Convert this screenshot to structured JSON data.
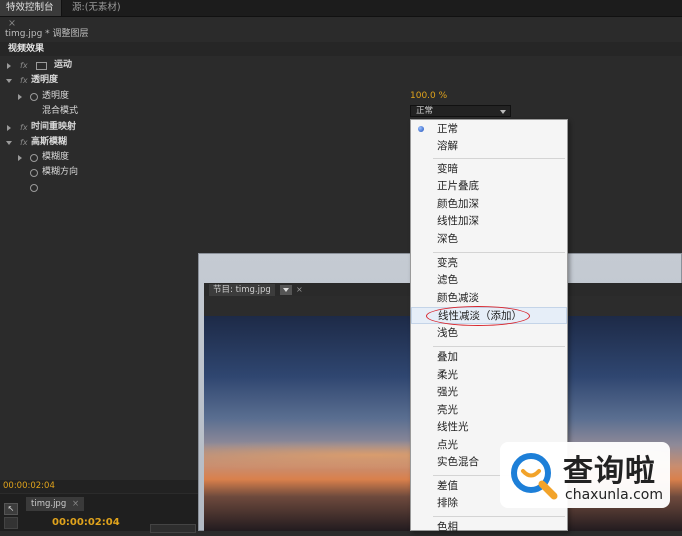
{
  "tabs": {
    "effect_controls": "特效控制台",
    "effect_controls_close": "×",
    "source": "源:(无素材)"
  },
  "clip": {
    "title": "timg.jpg * 调整图层"
  },
  "effects": {
    "section_label": "视频效果",
    "motion": "运动",
    "opacity_group": "透明度",
    "opacity": {
      "label": "透明度",
      "value": "100.0 %"
    },
    "blend_mode": {
      "label": "混合模式",
      "selected": "正常"
    },
    "time_remap": "时间重映射",
    "gaussian_blur": "高斯模糊",
    "blurriness": "模糊度",
    "blur_dimension": "模糊方向"
  },
  "timecode": "00:00:02:04",
  "timeline": {
    "sequence_tab": "timg.jpg",
    "sequence_close": "×",
    "timecode": "00:00:02:04"
  },
  "monitor": {
    "tab": "节目: timg.jpg",
    "close": "×"
  },
  "blend_menu": {
    "items": [
      "正常",
      "溶解",
      "变暗",
      "正片叠底",
      "颜色加深",
      "线性加深",
      "深色",
      "变亮",
      "滤色",
      "颜色减淡",
      "线性减淡（添加）",
      "浅色",
      "叠加",
      "柔光",
      "强光",
      "亮光",
      "线性光",
      "点光",
      "实色混合",
      "差值",
      "排除",
      "色相"
    ],
    "checked_item": "正常",
    "highlighted_item": "线性减淡（添加）"
  },
  "watermark": {
    "title": "查询啦",
    "url": "chaxunla.com"
  },
  "colors": {
    "accent_value": "#e0a31c",
    "annotation": "#d8262e",
    "panel": "#2b2b2b"
  }
}
